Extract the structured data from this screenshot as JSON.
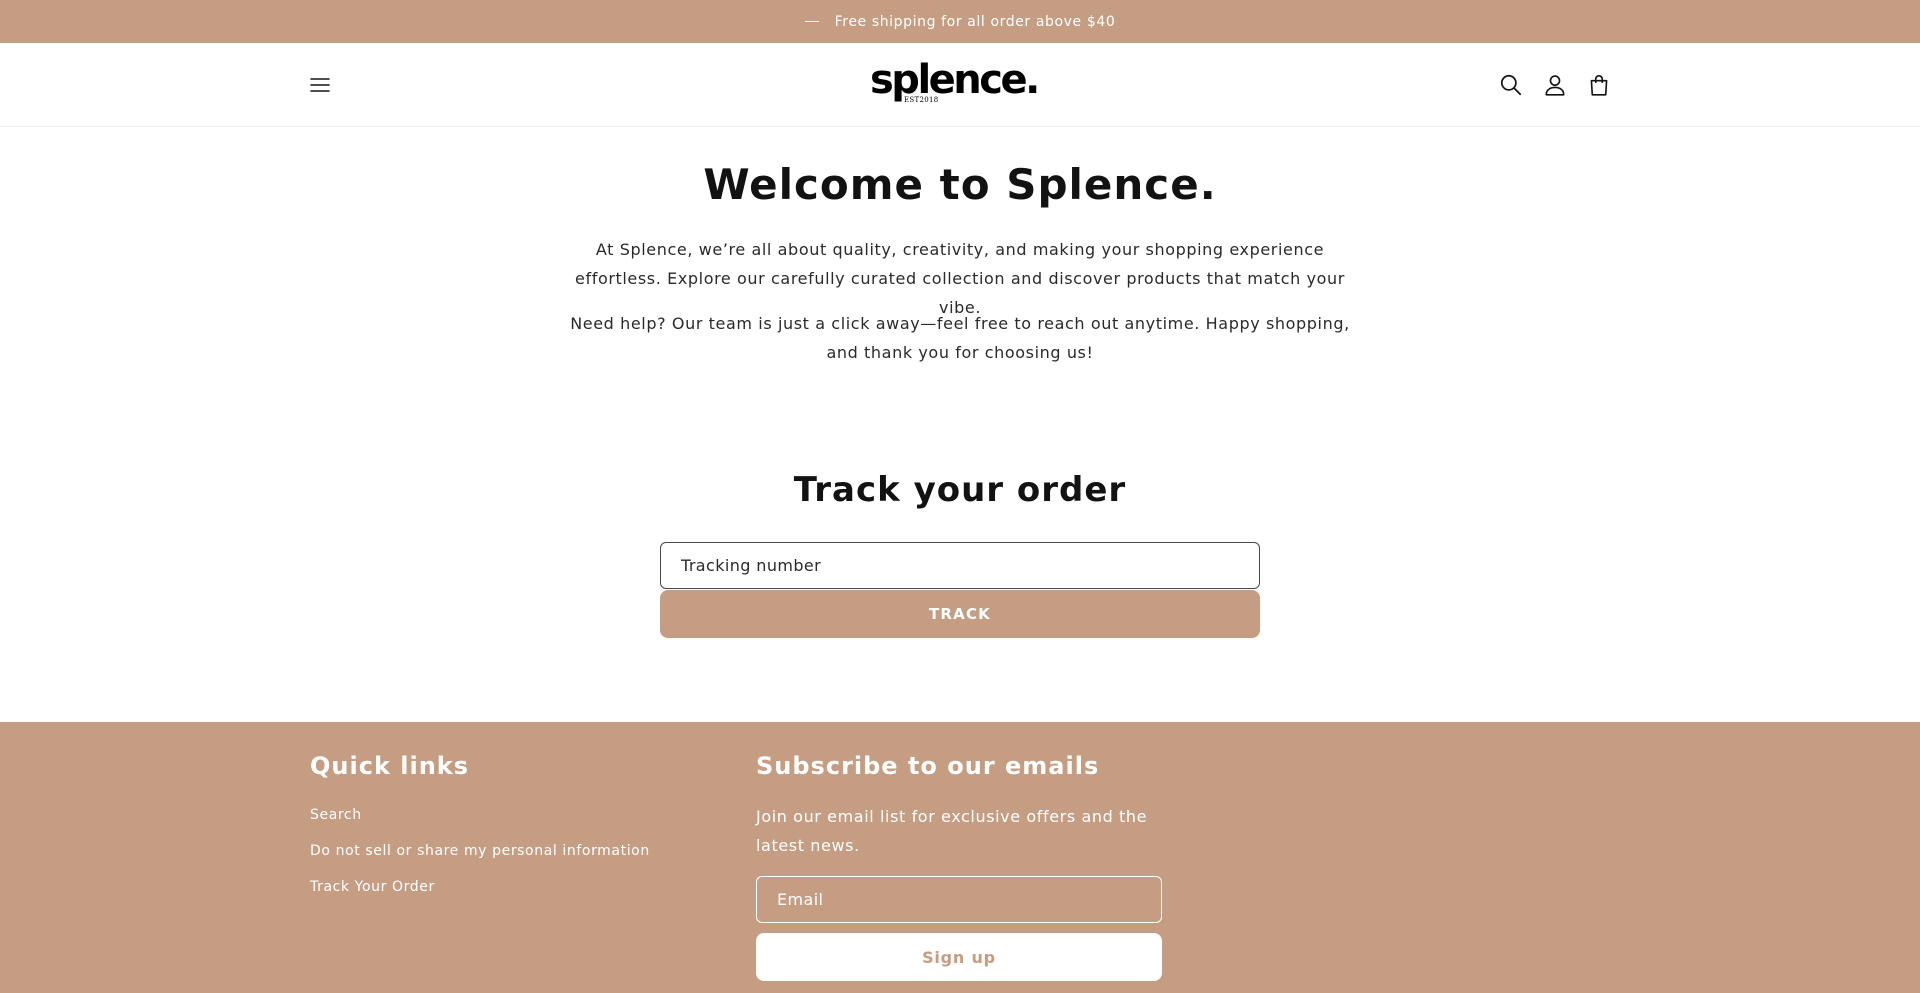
{
  "colors": {
    "accent": "#c49d83",
    "text": "#121212",
    "background": "#ffffff"
  },
  "announcement": {
    "text": "Free shipping for all order above $40"
  },
  "header": {
    "logo_text": "splence.",
    "logo_sub": "EST2018",
    "icons": [
      "menu-icon",
      "search-icon",
      "account-icon",
      "cart-icon"
    ]
  },
  "welcome": {
    "title": "Welcome to Splence.",
    "paragraph1": "At Splence, we’re all about quality, creativity, and making your shopping experience effortless. Explore our carefully curated collection and discover products that match your vibe.",
    "paragraph2": "Need help? Our team is just a click away—feel free to reach out anytime. Happy shopping, and thank you for choosing us!"
  },
  "tracking": {
    "title": "Track your order",
    "input_placeholder": "Tracking number",
    "button_label": "TRACK"
  },
  "footer": {
    "quick_links": {
      "heading": "Quick links",
      "items": [
        {
          "label": "Search"
        },
        {
          "label": "Do not sell or share my personal information"
        },
        {
          "label": "Track Your Order"
        }
      ]
    },
    "subscribe": {
      "heading": "Subscribe to our emails",
      "text": "Join our email list for exclusive offers and the latest news.",
      "email_placeholder": "Email",
      "button_label": "Sign up"
    }
  }
}
